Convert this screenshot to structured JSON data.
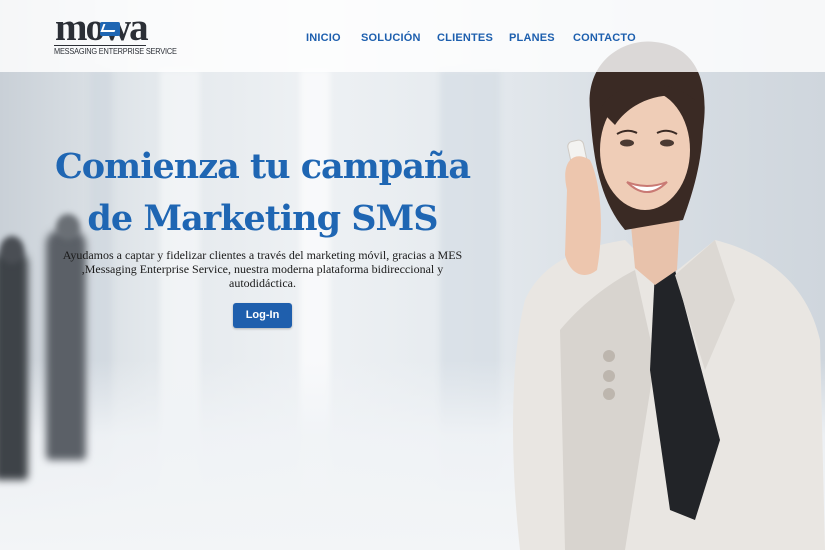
{
  "brand": {
    "logo_text": "mowa",
    "tagline": "MESSAGING ENTERPRISE SERVICE"
  },
  "nav": {
    "items": [
      {
        "label": "INICIO"
      },
      {
        "label": "SOLUCIÓN"
      },
      {
        "label": "CLIENTES"
      },
      {
        "label": "PLANES"
      },
      {
        "label": "CONTACTO"
      }
    ]
  },
  "hero": {
    "headline_line1": "Comienza tu campaña",
    "headline_line2": "de Marketing SMS",
    "description": "Ayudamos a captar y fidelizar clientes a través del marketing móvil, gracias a MES ,Messaging Enterprise Service, nuestra moderna plataforma bidireccional y autodidáctica.",
    "login_label": "Log-In"
  },
  "colors": {
    "brand_blue": "#1f66b3",
    "button_blue": "#1f5fad",
    "logo_dark": "#2b2f36"
  }
}
